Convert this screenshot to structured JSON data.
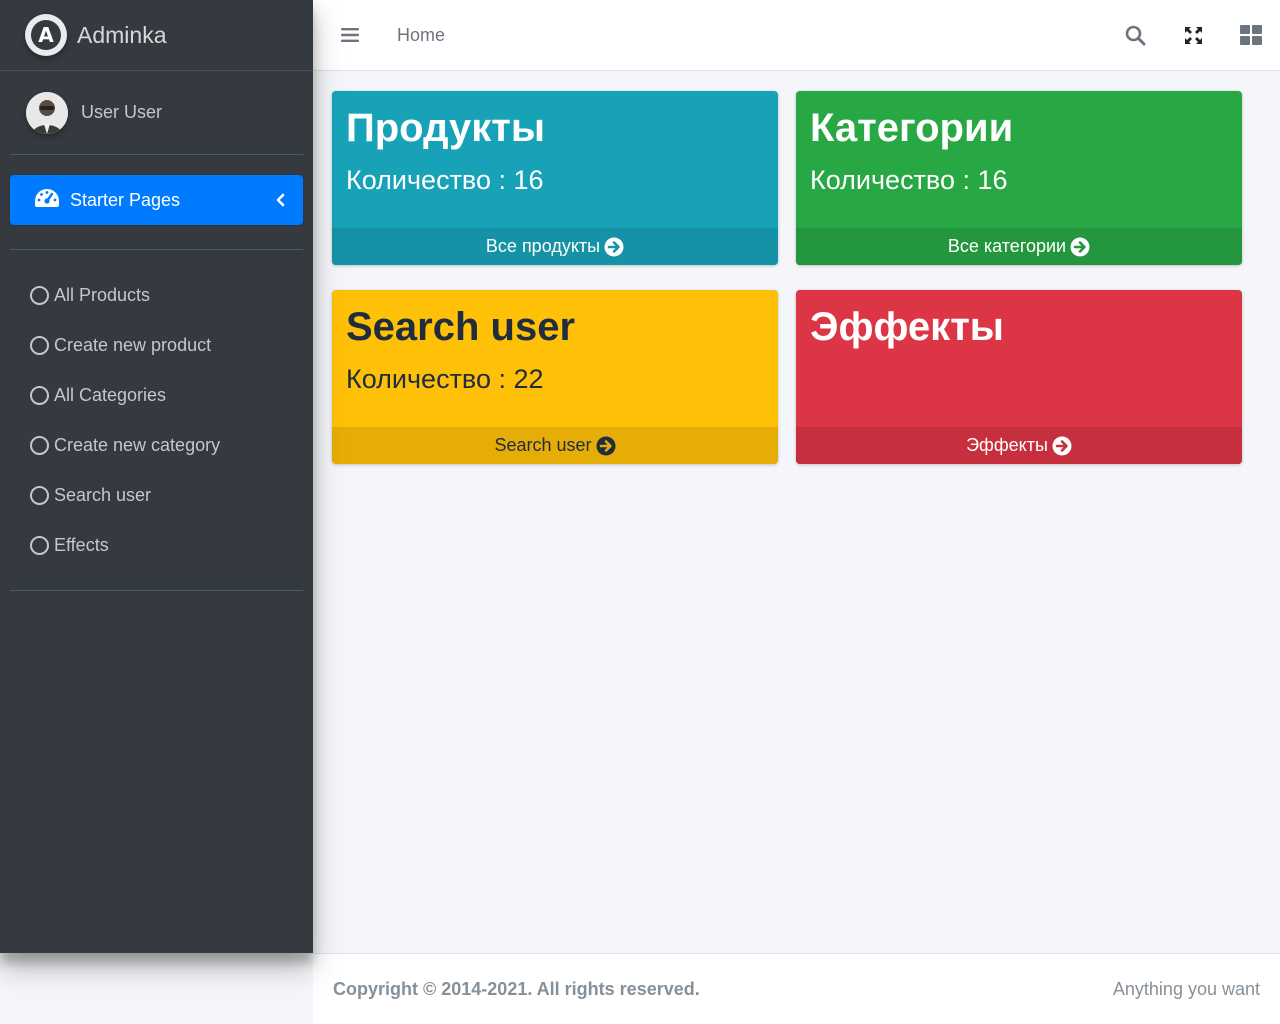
{
  "brand": {
    "name": "Adminka",
    "logo_letter": "A"
  },
  "user": {
    "name": "User User"
  },
  "sidebar": {
    "main_item": {
      "label": "Starter Pages",
      "icon": "tachometer-icon"
    },
    "items": [
      {
        "label": "All Products"
      },
      {
        "label": "Create new product"
      },
      {
        "label": "All Categories"
      },
      {
        "label": "Create new category"
      },
      {
        "label": "Search user"
      },
      {
        "label": "Effects"
      }
    ]
  },
  "header": {
    "home_label": "Home",
    "icons": [
      "menu-icon",
      "search-icon",
      "fullscreen-icon",
      "grid-icon"
    ]
  },
  "boxes": [
    {
      "title": "Продукты",
      "count": "Количество : 16",
      "footer": "Все продукты",
      "color": "#17a2b8"
    },
    {
      "title": "Категории",
      "count": "Количество : 16",
      "footer": "Все категории",
      "color": "#28a745"
    },
    {
      "title": "Search user",
      "count": "Количество : 22",
      "footer": "Search user",
      "color": "#ffc107"
    },
    {
      "title": "Эффекты",
      "count": "",
      "footer": "Эффекты",
      "color": "#dc3545"
    }
  ],
  "footer": {
    "copyright": "Copyright © 2014-2021. All rights reserved.",
    "right_text": "Anything you want"
  }
}
